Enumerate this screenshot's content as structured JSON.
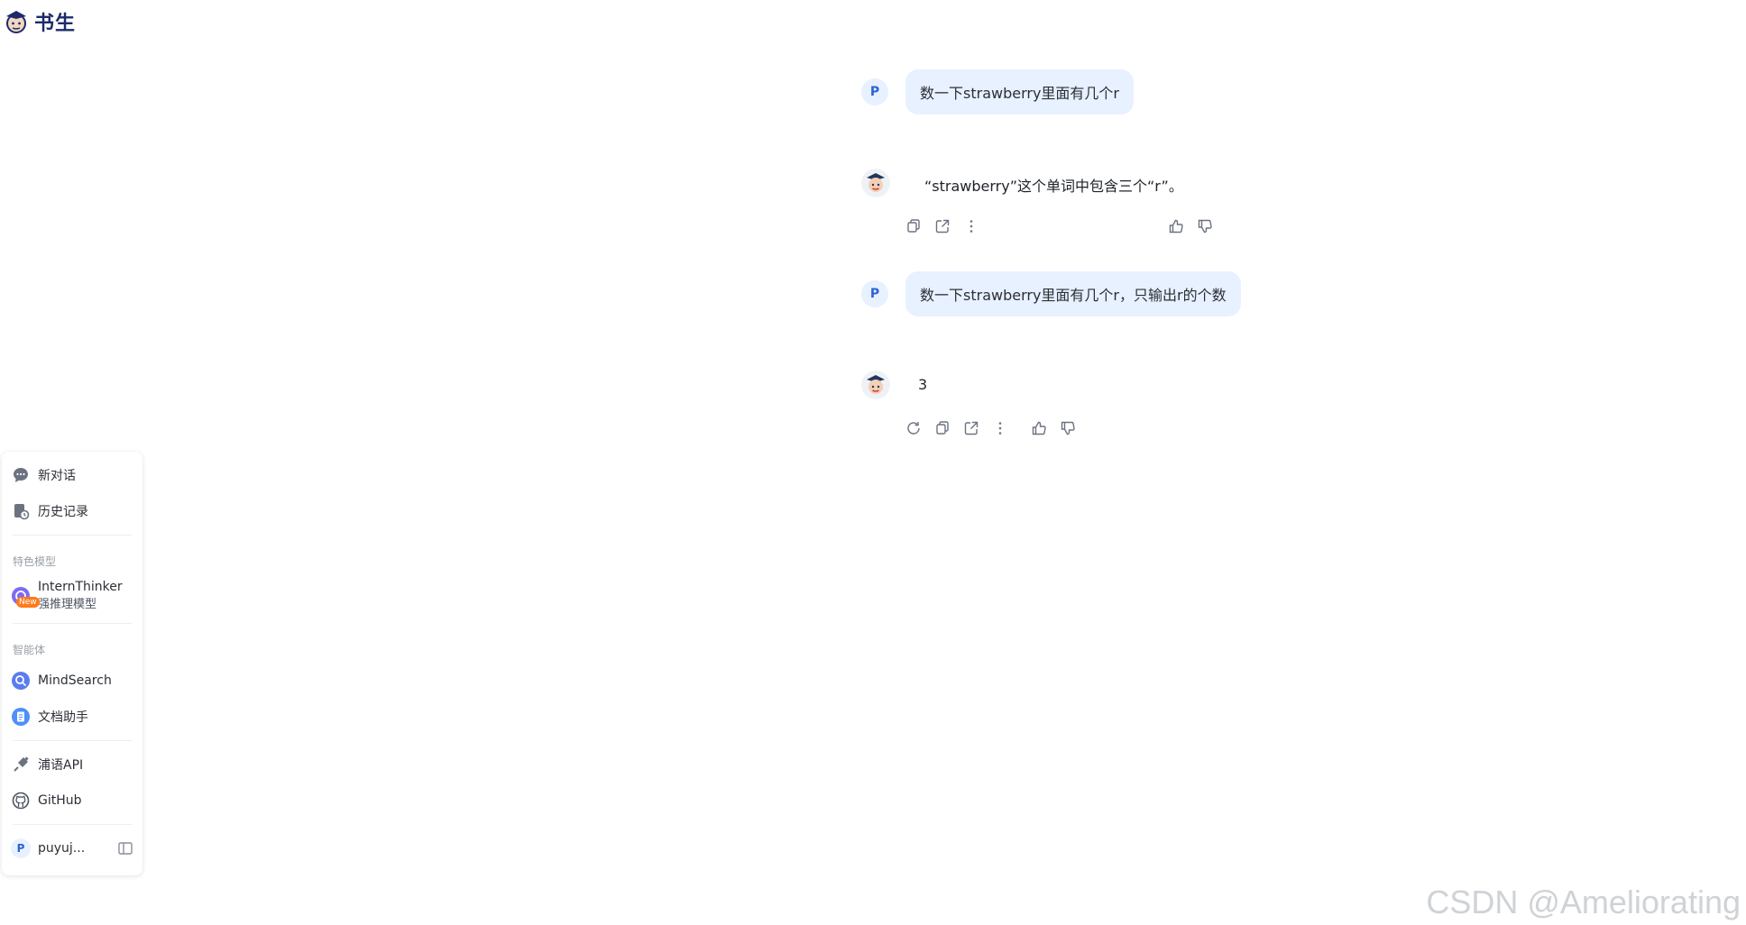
{
  "brand": {
    "name": "书生"
  },
  "sidebar": {
    "new_chat": "新对话",
    "history": "历史记录",
    "section_featured": "特色模型",
    "featured_model": {
      "name": "InternThinker",
      "subtitle": "强推理模型",
      "badge": "New"
    },
    "section_agents": "智能体",
    "agents": [
      "MindSearch",
      "文档助手"
    ],
    "links": [
      "浦语API",
      "GitHub"
    ],
    "user": {
      "initial": "P",
      "name": "puyuj..."
    }
  },
  "chat": {
    "user_initial": "P",
    "turns": [
      {
        "user": "数一下strawberry里面有几个r",
        "assistant": "“strawberry”这个单词中包含三个“r”。"
      },
      {
        "user": "数一下strawberry里面有几个r，只输出r的个数",
        "assistant": "3"
      }
    ]
  },
  "watermark": "CSDN @Ameliorating",
  "colors": {
    "accent": "#2a63d6",
    "bubble": "#e8f1ff",
    "badge": "#ff7a1a"
  }
}
